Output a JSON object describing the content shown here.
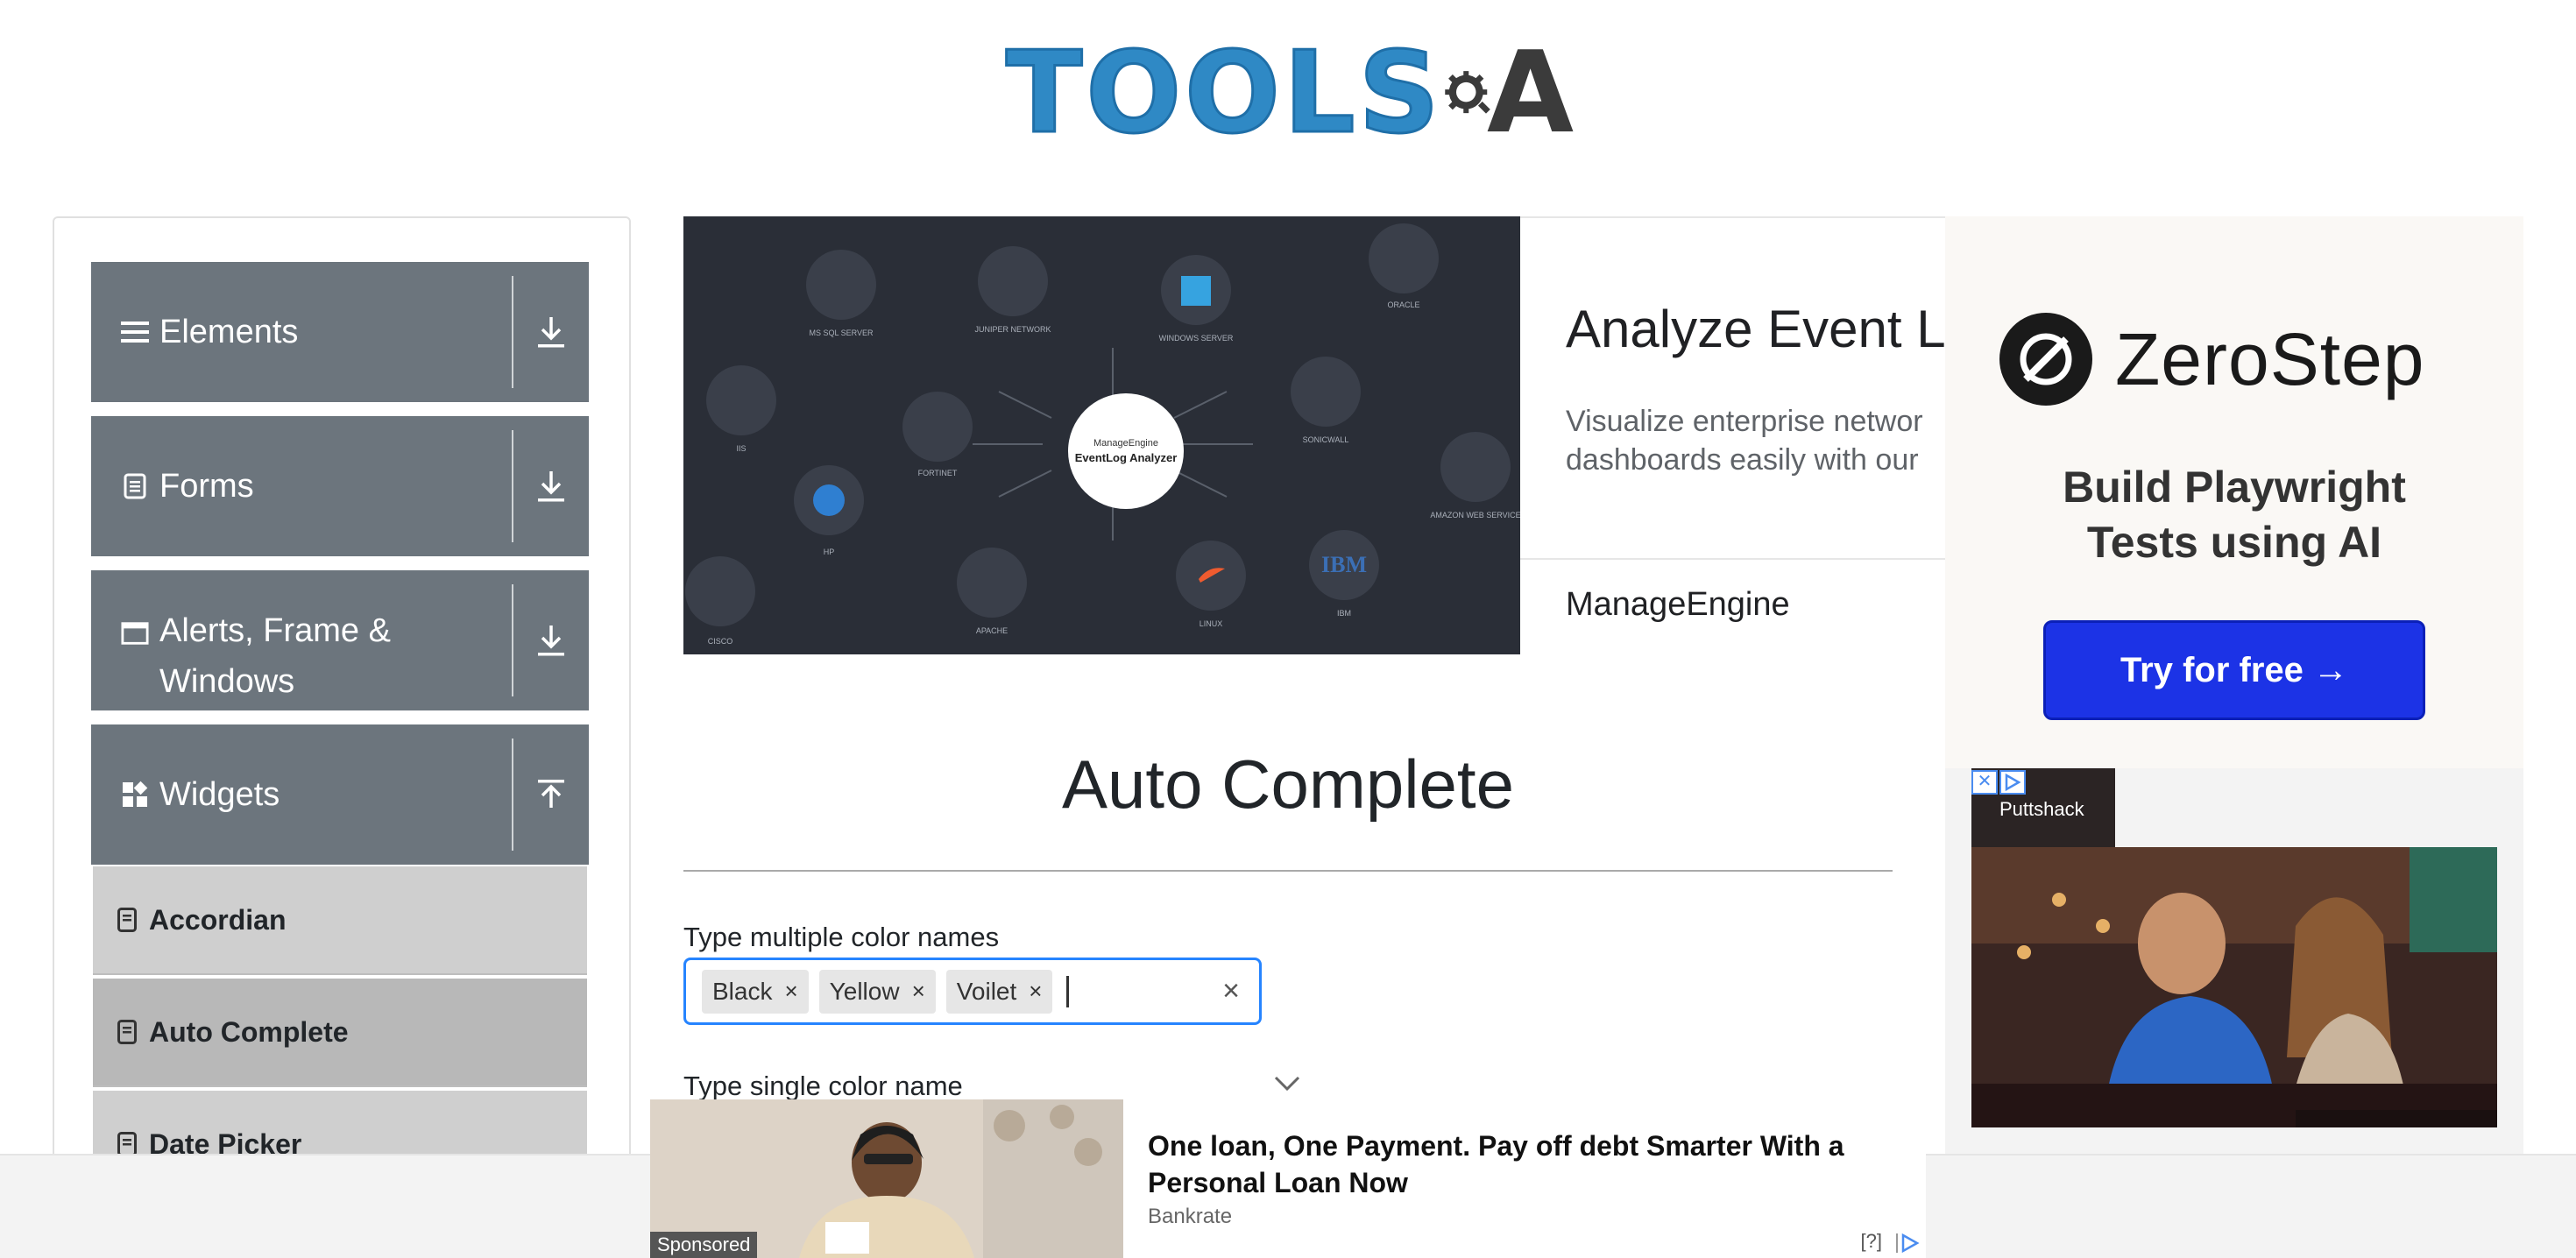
{
  "logo": {
    "text": "TOOLS",
    "suffix": "A"
  },
  "sidebar": {
    "groups": [
      {
        "label": "Elements",
        "icon": "hamburger-icon",
        "arrow": "download-icon"
      },
      {
        "label": "Forms",
        "icon": "document-icon",
        "arrow": "download-icon"
      },
      {
        "label": "Alerts, Frame & Windows",
        "icon": "window-icon",
        "arrow": "download-icon"
      },
      {
        "label": "Widgets",
        "icon": "widgets-icon",
        "arrow": "upload-icon"
      }
    ],
    "items": [
      {
        "label": "Accordian",
        "active": false
      },
      {
        "label": "Auto Complete",
        "active": true
      },
      {
        "label": "Date Picker",
        "active": false
      }
    ]
  },
  "banner": {
    "title": "Analyze Event Lo",
    "description": "Visualize enterprise networ\ndashboards easily with our",
    "brand": "ManageEngine",
    "center_brand": "ManageEngine",
    "center_product": "EventLog Analyzer",
    "nodes": [
      "MS SQL SERVER",
      "JUNIPER NETWORK",
      "WINDOWS SERVER",
      "ORACLE",
      "IIS",
      "FORTINET",
      "SONICWALL",
      "AMAZON WEB SERVICE",
      "HP",
      "CISCO",
      "APACHE",
      "LINUX",
      "IBM"
    ]
  },
  "main": {
    "title": "Auto Complete",
    "multi_label": "Type multiple color names",
    "chips": [
      "Black",
      "Yellow",
      "Voilet"
    ],
    "chip_remove": "×",
    "clear_all": "×",
    "single_label": "Type single color name"
  },
  "right_ad": {
    "brand": "ZeroStep",
    "headline": "Build Playwright\nTests using AI",
    "cta": "Try for free →",
    "second_ad_tab": "Puttshack"
  },
  "bottom_ad": {
    "sponsored": "Sponsored",
    "headline": "One loan, One Payment. Pay off debt Smarter With a Personal Loan Now",
    "source": "Bankrate",
    "help": "[?]"
  },
  "colors": {
    "sidebar_group": "#6c757d",
    "sidebar_item": "#cfcfcf",
    "focus_border": "#2684ff",
    "cta": "#1c33e6",
    "logo_blue": "#2f89c5"
  }
}
